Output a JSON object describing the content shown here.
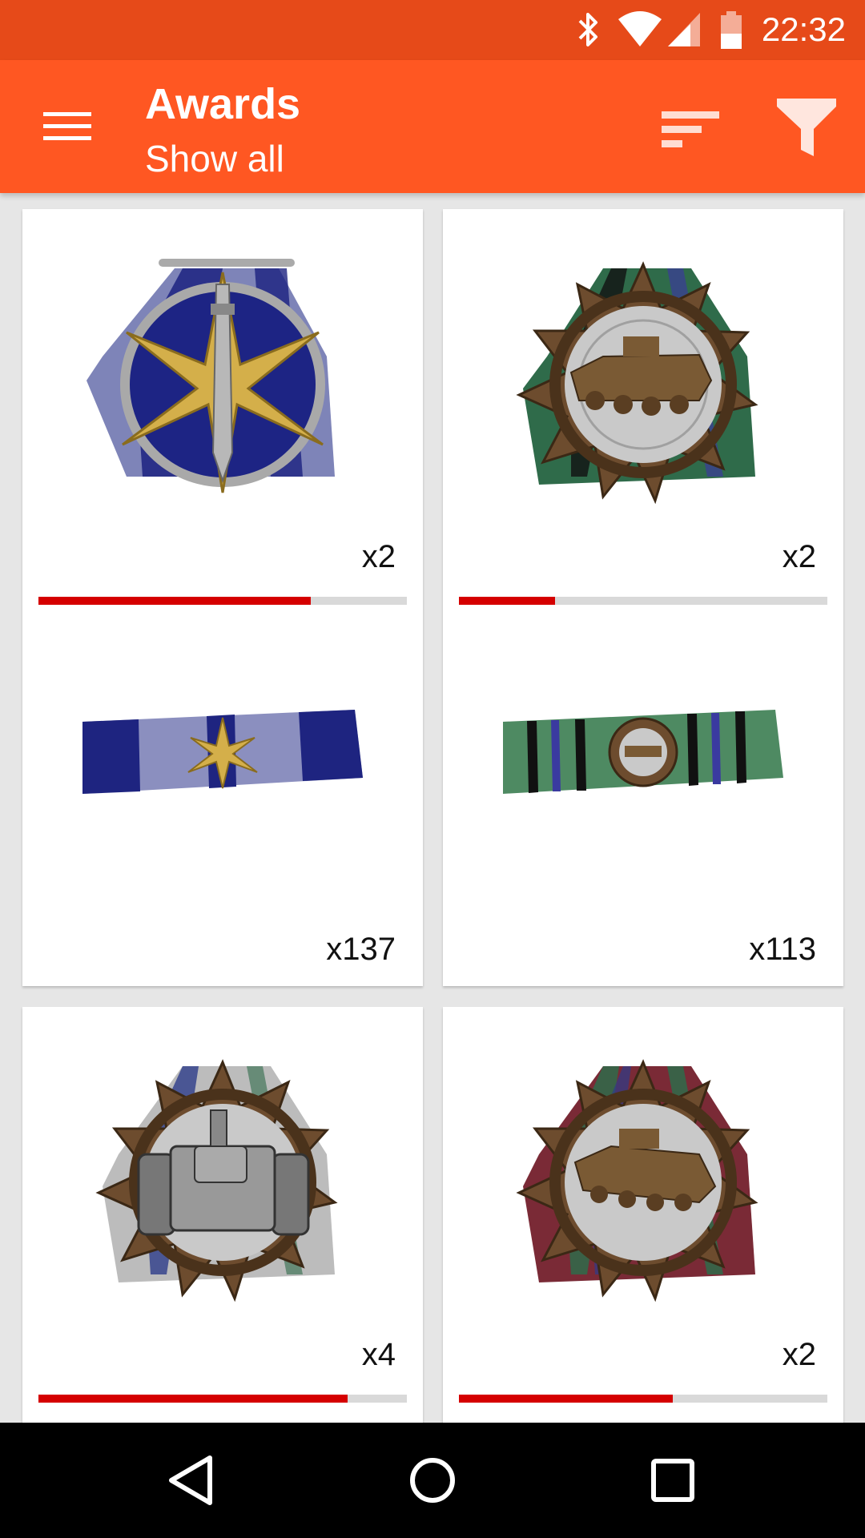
{
  "status_bar": {
    "time": "22:32",
    "icons": [
      "bluetooth-icon",
      "wifi-icon",
      "cell-signal-icon",
      "battery-icon"
    ]
  },
  "app_bar": {
    "title": "Awards",
    "subtitle": "Show all",
    "icons": [
      "menu-icon",
      "sort-icon",
      "filter-icon"
    ]
  },
  "colors": {
    "status_bar": "#e64a19",
    "app_bar": "#ff5722",
    "progress_fill": "#d50000",
    "progress_track": "#d9d9d9"
  },
  "awards": [
    {
      "medal": {
        "name": "combat-knife-star-medal",
        "count": "x2",
        "progress": 0.74
      },
      "ribbon": {
        "name": "blue-white-ribbon",
        "count": "x137"
      }
    },
    {
      "medal": {
        "name": "ifv-bronze-wreath-medal",
        "count": "x2",
        "progress": 0.26
      },
      "ribbon": {
        "name": "green-black-ribbon",
        "count": "x113"
      }
    },
    {
      "medal": {
        "name": "tank-bronze-wreath-medal",
        "count": "x4",
        "progress": 0.84
      }
    },
    {
      "medal": {
        "name": "ifv-bronze-wreath-medal-red",
        "count": "x2",
        "progress": 0.58
      }
    }
  ],
  "nav_bar": {
    "icons": [
      "back-icon",
      "home-icon",
      "recents-icon"
    ]
  }
}
